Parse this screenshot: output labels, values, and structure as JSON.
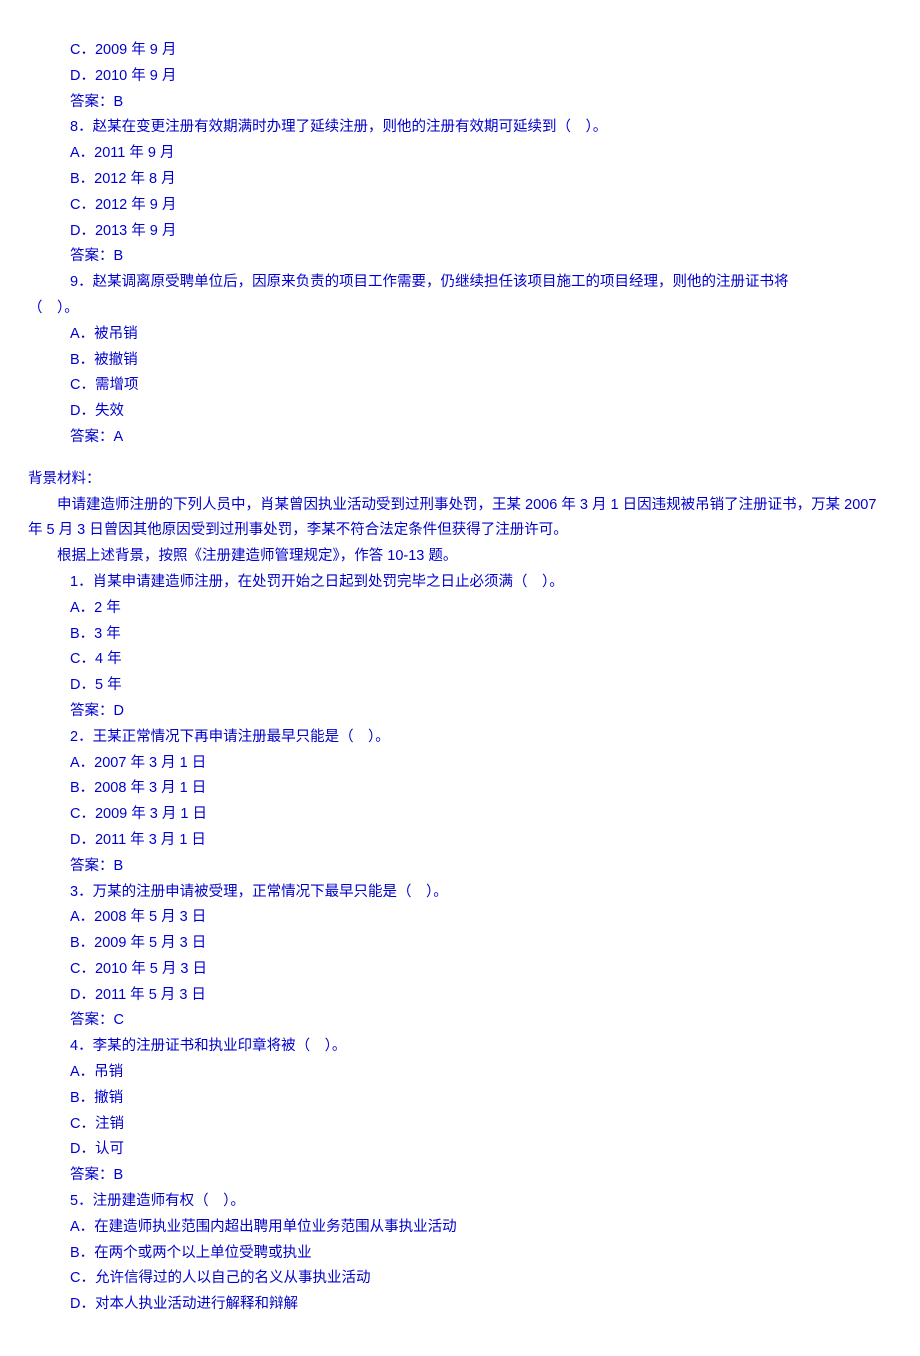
{
  "group1": {
    "q7_optC": "C．2009 年 9 月",
    "q7_optD": "D．2010 年 9 月",
    "q7_ans": "答案：B",
    "q8_stem": "8．赵某在变更注册有效期满时办理了延续注册，则他的注册有效期可延续到（　）。",
    "q8_optA": "A．2011 年 9 月",
    "q8_optB": "B．2012 年 8 月",
    "q8_optC": "C．2012 年 9 月",
    "q8_optD": "D．2013 年 9 月",
    "q8_ans": "答案：B",
    "q9_stem": "9．赵某调离原受聘单位后，因原来负责的项目工作需要，仍继续担任该项目施工的项目经理，则他的注册证书将",
    "q9_stem_tail": "（　）。",
    "q9_optA": "A．被吊销",
    "q9_optB": "B．被撤销",
    "q9_optC": "C．需增项",
    "q9_optD": "D．失效",
    "q9_ans": "答案：A"
  },
  "group2": {
    "bg_title": "背景材料：",
    "bg_line1a": "　　申请建造师注册的下列人员中，肖某曾因执业活动受到过刑事处罚，王某 ",
    "bg_line1b": "2006",
    "bg_line1c": " 年 ",
    "bg_line1d": "3",
    "bg_line1e": " 月 ",
    "bg_line1f": "1",
    "bg_line1g": " 日因违规被吊销了注册证书，万某 ",
    "bg_line1h": "2007",
    "bg_line1i": " 年 ",
    "bg_line1j": "5",
    "bg_line1k": " 月 ",
    "bg_line1l": "3",
    "bg_line1m": " 日曾因其他原因受到过刑事处罚，李某不符合法定条件但获得了注册许可。",
    "bg_line2a": "　　根据上述背景，按照《注册建造师管理规定》，作答 ",
    "bg_line2b": "10-13",
    "bg_line2c": " 题。",
    "q1_stem": "1．肖某申请建造师注册，在处罚开始之日起到处罚完毕之日止必须满（　）。",
    "q1_optA": "A．2 年",
    "q1_optB": "B．3 年",
    "q1_optC": "C．4 年",
    "q1_optD": "D．5 年",
    "q1_ans": "答案：D",
    "q2_stem": "2．王某正常情况下再申请注册最早只能是（　）。",
    "q2_optA": "A．2007 年 3 月 1 日",
    "q2_optB": "B．2008 年 3 月 1 日",
    "q2_optC": "C．2009 年 3 月 1 日",
    "q2_optD": "D．2011 年 3 月 1 日",
    "q2_ans": "答案：B",
    "q3_stem": "3．万某的注册申请被受理，正常情况下最早只能是（　）。",
    "q3_optA": "A．2008 年 5 月 3 日",
    "q3_optB": "B．2009 年 5 月 3 日",
    "q3_optC": "C．2010 年 5 月 3 日",
    "q3_optD": "D．2011 年 5 月 3 日",
    "q3_ans": "答案：C",
    "q4_stem": "4．李某的注册证书和执业印章将被（　）。",
    "q4_optA": "A．吊销",
    "q4_optB": "B．撤销",
    "q4_optC": "C．注销",
    "q4_optD": "D．认可",
    "q4_ans": "答案：B",
    "q5_stem": "5．注册建造师有权（　）。",
    "q5_optA": "A．在建造师执业范围内超出聘用单位业务范围从事执业活动",
    "q5_optB": "B．在两个或两个以上单位受聘或执业",
    "q5_optC": "C．允许信得过的人以自己的名义从事执业活动",
    "q5_optD": "D．对本人执业活动进行解释和辩解"
  }
}
